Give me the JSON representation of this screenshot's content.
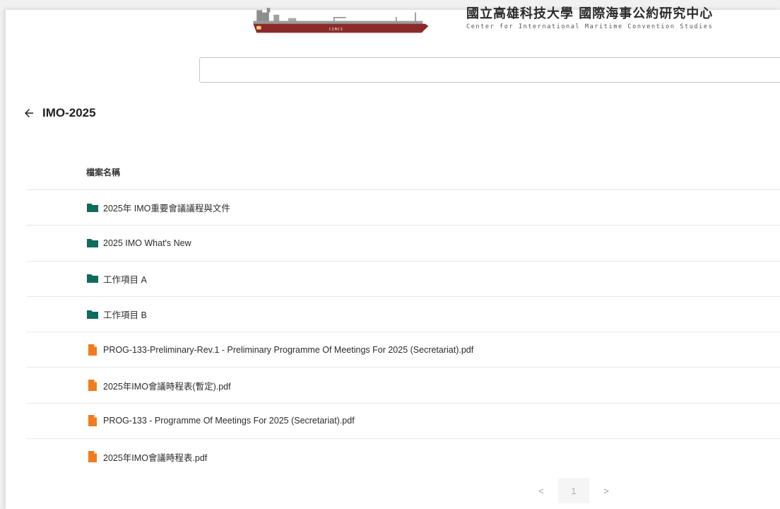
{
  "header": {
    "logo_badge": "CIMCS",
    "org_name_cn": "國立高雄科技大學 國際海事公約研究中心",
    "org_name_en": "Center for International Maritime Convention Studies"
  },
  "search": {
    "value": "",
    "placeholder": ""
  },
  "folder": {
    "title": "IMO-2025",
    "back_icon": "arrow-left-icon"
  },
  "table": {
    "column_header": "檔案名稱",
    "rows": [
      {
        "type": "folder",
        "name": "2025年 IMO重要會議議程與文件"
      },
      {
        "type": "folder",
        "name": "2025 IMO What's New"
      },
      {
        "type": "folder",
        "name": "工作項目 A"
      },
      {
        "type": "folder",
        "name": "工作項目 B"
      },
      {
        "type": "pdf",
        "name": "PROG-133-Preliminary-Rev.1 - Preliminary Programme Of Meetings For 2025 (Secretariat).pdf"
      },
      {
        "type": "pdf",
        "name": "2025年IMO會議時程表(暫定).pdf"
      },
      {
        "type": "pdf",
        "name": "PROG-133 - Programme Of Meetings For 2025 (Secretariat).pdf"
      },
      {
        "type": "pdf",
        "name": "2025年IMO會議時程表.pdf"
      }
    ]
  },
  "pagination": {
    "prev": "<",
    "current": "1",
    "next": ">"
  },
  "colors": {
    "folder_icon": "#0f6b5c",
    "pdf_icon": "#f07c1d",
    "ship_hull": "#8b2a2a"
  }
}
